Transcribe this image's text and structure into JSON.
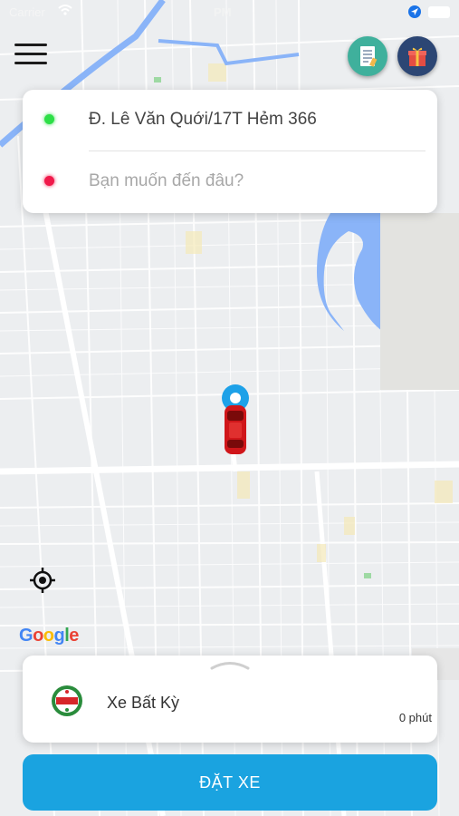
{
  "status_bar": {
    "carrier": "Carrier",
    "time": "PM",
    "icons": [
      "wifi-icon",
      "location-arrow-icon",
      "battery-icon"
    ]
  },
  "header": {
    "menu_icon": "hamburger-menu-icon",
    "history_icon": "receipt-icon",
    "gift_icon": "gift-icon",
    "colors": {
      "history": "#3fb09c",
      "gift": "#2c4674"
    }
  },
  "address": {
    "pickup": "Đ. Lê Văn Quới/17T Hẻm 366",
    "destination_placeholder": "Bạn muốn đến đâu?",
    "colors": {
      "pickup_dot": "#2ddf47",
      "destination_dot": "#f0194a"
    }
  },
  "map": {
    "provider": "Google",
    "marker_icon": "pickup-pin-icon",
    "car_icon": "red-car-icon",
    "locate_icon": "my-location-icon"
  },
  "vehicle": {
    "logo_icon": "taxi-logo-icon",
    "name": "Xe Bất Kỳ",
    "eta": "0 phút"
  },
  "book_button": {
    "label": "ĐẶT XE",
    "color": "#1aa3e0"
  }
}
